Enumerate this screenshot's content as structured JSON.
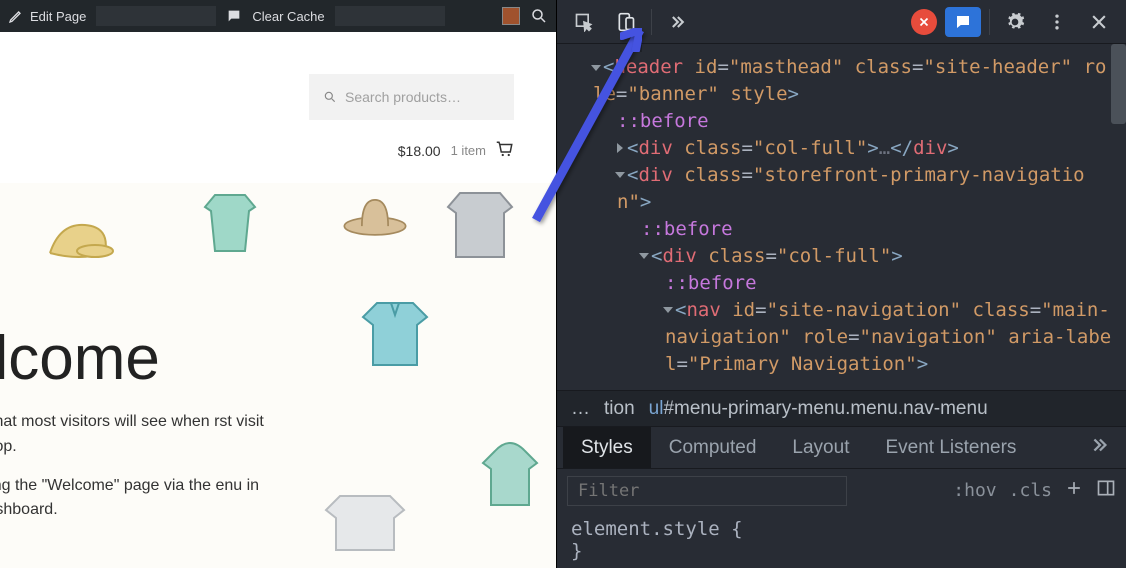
{
  "admin_bar": {
    "edit_page": "Edit Page",
    "clear_cache": "Clear Cache"
  },
  "site": {
    "search_placeholder": "Search products…",
    "cart_price": "$18.00",
    "cart_items": "1 item",
    "hero_title": "elcome",
    "hero_p1": "ich is what most visitors will see when rst visit your shop.",
    "hero_p2": "by editing the \"Welcome\" page via the enu in your dashboard."
  },
  "devtools": {
    "dom": {
      "header_open": "<header id=\"masthead\" class=\"site-header\" role=\"banner\" style>",
      "before": "::before",
      "div_colfull_collapsed": "<div class=\"col-full\">…</div>",
      "div_nav_open": "<div class=\"storefront-primary-navigation\">",
      "div_colfull_open": "<div class=\"col-full\">",
      "nav_open": "<nav id=\"site-navigation\" class=\"main-navigation\" role=\"navigation\" aria-label=\"Primary Navigation\">"
    },
    "breadcrumb": {
      "ellipsis": "…",
      "item1": "tion",
      "sel_tag": "ul",
      "sel_id": "#menu-primary-menu",
      "sel_classes": ".menu.nav-menu"
    },
    "tabs": [
      "Styles",
      "Computed",
      "Layout",
      "Event Listeners"
    ],
    "filter_placeholder": "Filter",
    "hov": ":hov",
    "cls": ".cls",
    "css_line1": "element.style {",
    "css_line2": "}"
  }
}
